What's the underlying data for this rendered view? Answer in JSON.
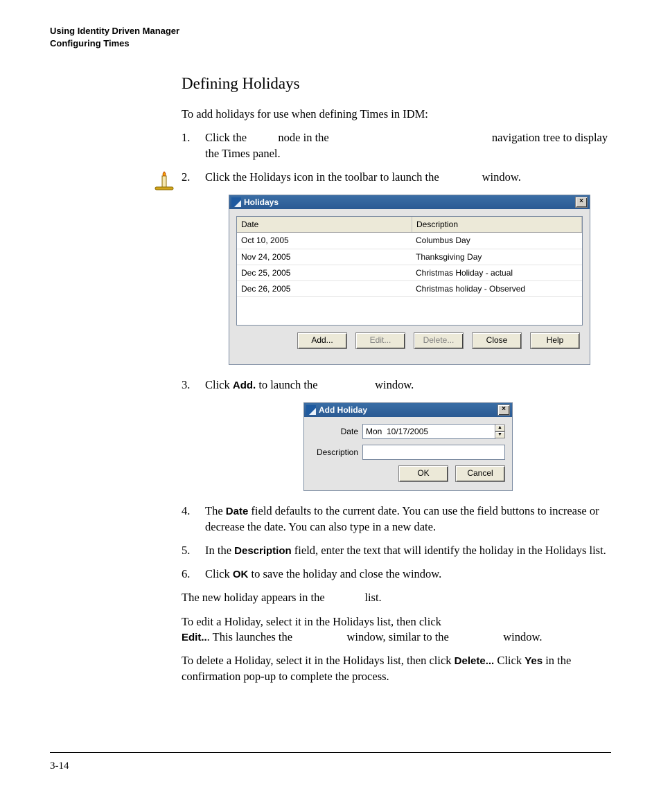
{
  "header": {
    "line1": "Using Identity Driven Manager",
    "line2": "Configuring Times"
  },
  "title": "Defining Holidays",
  "intro": "To add holidays for use when defining Times in IDM:",
  "steps": {
    "s1a": "Click the ",
    "s1b": " node in the ",
    "s1c": " navigation tree to display the Times panel.",
    "s2a": "Click the Holidays icon in the toolbar to launch the ",
    "s2b": " window.",
    "s3a": "Click ",
    "s3b": "Add.",
    "s3c": " to launch the ",
    "s3d": " window.",
    "s4a": "The ",
    "s4b": "Date",
    "s4c": " field defaults to the current date. You can use the field buttons to increase or decrease the date. You can also type in a new date.",
    "s5a": "In the ",
    "s5b": "Description",
    "s5c": " field, enter the text that will identify the holiday in the Holidays list.",
    "s6a": "Click ",
    "s6b": "OK",
    "s6c": " to save the holiday and close the window."
  },
  "p_after": "The new holiday appears in the              list.",
  "p_edit_a": "To edit a Holiday, select it in the Holidays list, then click ",
  "p_edit_b": "Edit..",
  "p_edit_c": ". This launches the                   window, similar to the                   window.",
  "p_del_a": "To delete a Holiday, select it in the Holidays list, then click ",
  "p_del_b": "Delete...",
  "p_del_c": " Click ",
  "p_del_d": "Yes",
  "p_del_e": " in the confirmation pop-up to complete the process.",
  "dialog1": {
    "title": "Holidays",
    "col1": "Date",
    "col2": "Description",
    "rows": [
      {
        "date": "Oct 10, 2005",
        "desc": "Columbus Day"
      },
      {
        "date": "Nov 24, 2005",
        "desc": "Thanksgiving Day"
      },
      {
        "date": "Dec 25, 2005",
        "desc": "Christmas Holiday - actual"
      },
      {
        "date": "Dec 26, 2005",
        "desc": "Christmas holiday - Observed"
      }
    ],
    "buttons": {
      "add": "Add...",
      "edit": "Edit...",
      "delete": "Delete...",
      "close": "Close",
      "help": "Help"
    }
  },
  "dialog2": {
    "title": "Add Holiday",
    "date_label": "Date",
    "date_value": "Mon  10/17/2005",
    "desc_label": "Description",
    "desc_value": "",
    "ok": "OK",
    "cancel": "Cancel"
  },
  "pageno": "3-14"
}
